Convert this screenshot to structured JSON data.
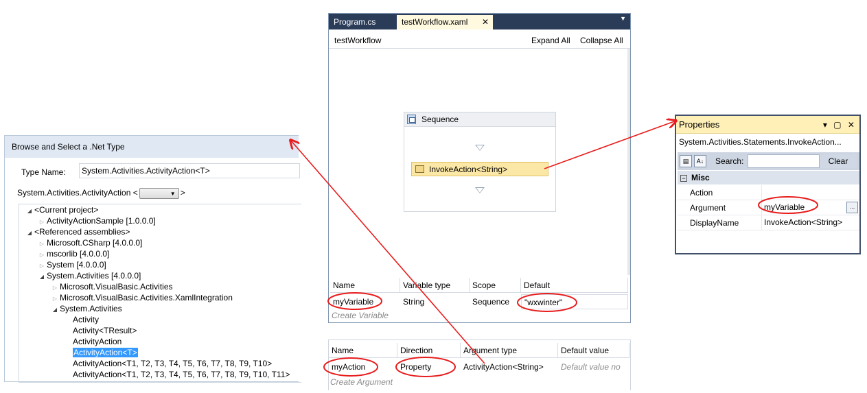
{
  "browse_dialog": {
    "title": "Browse and Select a .Net Type",
    "type_name_label": "Type Name:",
    "type_name_value": "System.Activities.ActivityAction<T>",
    "generic_prefix": "System.Activities.ActivityAction <",
    "generic_suffix": ">",
    "tree": [
      "<Current project>",
      "ActivityActionSample [1.0.0.0]",
      "<Referenced assemblies>",
      "Microsoft.CSharp [4.0.0.0]",
      "mscorlib [4.0.0.0]",
      "System [4.0.0.0]",
      "System.Activities [4.0.0.0]",
      "Microsoft.VisualBasic.Activities",
      "Microsoft.VisualBasic.Activities.XamlIntegration",
      "System.Activities",
      "Activity",
      "Activity<TResult>",
      "ActivityAction",
      "ActivityAction<T>",
      "ActivityAction<T1, T2, T3, T4, T5, T6, T7, T8, T9, T10>",
      "ActivityAction<T1, T2, T3, T4, T5, T6, T7, T8, T9, T10, T11>"
    ]
  },
  "designer": {
    "tabs": [
      "Program.cs",
      "testWorkflow.xaml"
    ],
    "close_glyph": "✕",
    "dropdown_glyph": "▼",
    "workflow_title": "testWorkflow",
    "expand_all": "Expand All",
    "collapse_all": "Collapse All",
    "sequence_title": "Sequence",
    "invoke_label": "InvokeAction<String>",
    "variables": {
      "headers": [
        "Name",
        "Variable type",
        "Scope",
        "Default"
      ],
      "row": [
        "myVariable",
        "String",
        "Sequence",
        "\"wxwinter\""
      ],
      "create": "Create Variable"
    },
    "arguments": {
      "headers": [
        "Name",
        "Direction",
        "Argument type",
        "Default value"
      ],
      "row": [
        "myAction",
        "Property",
        "ActivityAction<String>",
        "Default value no"
      ],
      "create": "Create Argument"
    }
  },
  "properties": {
    "title": "Properties",
    "title_buttons": "▾ ▢ ✕",
    "type": "System.Activities.Statements.InvokeAction...",
    "search_label": "Search:",
    "clear": "Clear",
    "category": "Misc",
    "category_toggle": "−",
    "ellipsis": "...",
    "rows": [
      {
        "name": "Action",
        "value": ""
      },
      {
        "name": "Argument",
        "value": "myVariable"
      },
      {
        "name": "DisplayName",
        "value": "InvokeAction<String>"
      }
    ]
  },
  "colors": {
    "annotation": "#e81c1c",
    "selection": "#3399ff",
    "tab_bar": "#2b3c59",
    "invoke_fill": "#fce8a6"
  }
}
